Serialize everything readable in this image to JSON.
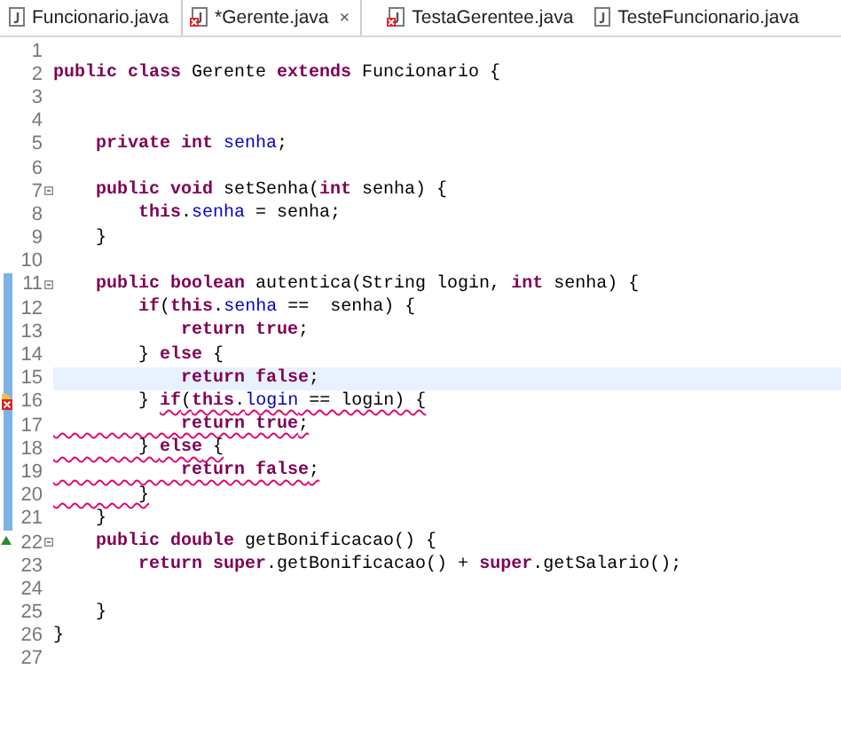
{
  "tabs": [
    {
      "label": "Funcionario.java",
      "selected": false,
      "error": false
    },
    {
      "label": "*Gerente.java",
      "selected": true,
      "error": true,
      "close": "×"
    },
    {
      "label": "TestaGerentee.java",
      "selected": false,
      "error": true
    },
    {
      "label": "TesteFuncionario.java",
      "selected": false,
      "error": false
    }
  ],
  "editor": {
    "lines": [
      {
        "number": "1"
      },
      {
        "number": "2",
        "tokens": [
          {
            "kind": "keyword",
            "text": "public class"
          },
          {
            "kind": "plain",
            "text": " Gerente "
          },
          {
            "kind": "keyword",
            "text": "extends"
          },
          {
            "kind": "plain",
            "text": " Funcionario {"
          }
        ]
      },
      {
        "number": "3"
      },
      {
        "number": "4"
      },
      {
        "number": "5",
        "tokens": [
          {
            "kind": "keyword",
            "text": "    private int"
          },
          {
            "kind": "field",
            "text": " senha"
          },
          {
            "kind": "plain",
            "text": ";"
          }
        ]
      },
      {
        "number": "6"
      },
      {
        "number": "7",
        "fold": true,
        "tokens": [
          {
            "kind": "keyword",
            "text": "    public void"
          },
          {
            "kind": "plain",
            "text": " setSenha("
          },
          {
            "kind": "keyword",
            "text": "int"
          },
          {
            "kind": "plain",
            "text": " senha) {"
          }
        ]
      },
      {
        "number": "8",
        "tokens": [
          {
            "kind": "keyword",
            "text": "        this"
          },
          {
            "kind": "plain",
            "text": "."
          },
          {
            "kind": "field",
            "text": "senha"
          },
          {
            "kind": "plain",
            "text": " = senha;"
          }
        ]
      },
      {
        "number": "9",
        "tokens": [
          {
            "kind": "plain",
            "text": "    }"
          }
        ]
      },
      {
        "number": "10"
      },
      {
        "number": "11",
        "fold": true,
        "changed": true,
        "tokens": [
          {
            "kind": "keyword",
            "text": "    public boolean"
          },
          {
            "kind": "plain",
            "text": " autentica(String login, "
          },
          {
            "kind": "keyword",
            "text": "int"
          },
          {
            "kind": "plain",
            "text": " senha) {"
          }
        ]
      },
      {
        "number": "12",
        "changed": true,
        "tokens": [
          {
            "kind": "keyword",
            "text": "        if"
          },
          {
            "kind": "plain",
            "text": "("
          },
          {
            "kind": "keyword",
            "text": "this"
          },
          {
            "kind": "plain",
            "text": "."
          },
          {
            "kind": "field",
            "text": "senha"
          },
          {
            "kind": "plain",
            "text": " ==  senha) {"
          }
        ]
      },
      {
        "number": "13",
        "changed": true,
        "tokens": [
          {
            "kind": "keyword",
            "text": "            return true"
          },
          {
            "kind": "plain",
            "text": ";"
          }
        ]
      },
      {
        "number": "14",
        "changed": true,
        "tokens": [
          {
            "kind": "plain",
            "text": "        } "
          },
          {
            "kind": "keyword",
            "text": "else"
          },
          {
            "kind": "plain",
            "text": " {"
          }
        ]
      },
      {
        "number": "15",
        "changed": true,
        "current": true,
        "tokens": [
          {
            "kind": "keyword",
            "text": "            return false"
          },
          {
            "kind": "plain",
            "text": ";"
          }
        ]
      },
      {
        "number": "16",
        "changed": true,
        "error_marker": true,
        "tokens": [
          {
            "kind": "plain",
            "text": "        } "
          },
          {
            "kind": "keyword",
            "text": "if",
            "error": true
          },
          {
            "kind": "plain",
            "text": "(",
            "error": true
          },
          {
            "kind": "keyword",
            "text": "this",
            "error": true
          },
          {
            "kind": "plain",
            "text": ".",
            "error": true
          },
          {
            "kind": "field",
            "text": "login",
            "error": true
          },
          {
            "kind": "plain",
            "text": " == login) {",
            "error": true
          }
        ]
      },
      {
        "number": "17",
        "changed": true,
        "tokens": [
          {
            "kind": "keyword",
            "text": "            return true",
            "error": true
          },
          {
            "kind": "plain",
            "text": ";",
            "error": true
          }
        ]
      },
      {
        "number": "18",
        "changed": true,
        "tokens": [
          {
            "kind": "plain",
            "text": "        } ",
            "error": true
          },
          {
            "kind": "keyword",
            "text": "else",
            "error": true
          },
          {
            "kind": "plain",
            "text": " {",
            "error": true
          }
        ]
      },
      {
        "number": "19",
        "changed": true,
        "tokens": [
          {
            "kind": "keyword",
            "text": "            return false",
            "error": true
          },
          {
            "kind": "plain",
            "text": ";",
            "error": true
          }
        ]
      },
      {
        "number": "20",
        "changed": true,
        "tokens": [
          {
            "kind": "plain",
            "text": "        }",
            "error": true
          }
        ]
      },
      {
        "number": "21",
        "changed": true,
        "tokens": [
          {
            "kind": "plain",
            "text": "    }"
          }
        ]
      },
      {
        "number": "22",
        "fold": true,
        "override_marker": true,
        "tokens": [
          {
            "kind": "keyword",
            "text": "    public double"
          },
          {
            "kind": "plain",
            "text": " getBonificacao() {"
          }
        ]
      },
      {
        "number": "23",
        "tokens": [
          {
            "kind": "keyword",
            "text": "        return super"
          },
          {
            "kind": "plain",
            "text": ".getBonificacao() + "
          },
          {
            "kind": "keyword",
            "text": "super"
          },
          {
            "kind": "plain",
            "text": ".getSalario();"
          }
        ]
      },
      {
        "number": "24"
      },
      {
        "number": "25",
        "tokens": [
          {
            "kind": "plain",
            "text": "    }"
          }
        ]
      },
      {
        "number": "26",
        "tokens": [
          {
            "kind": "plain",
            "text": "}"
          }
        ]
      },
      {
        "number": "27"
      }
    ]
  }
}
